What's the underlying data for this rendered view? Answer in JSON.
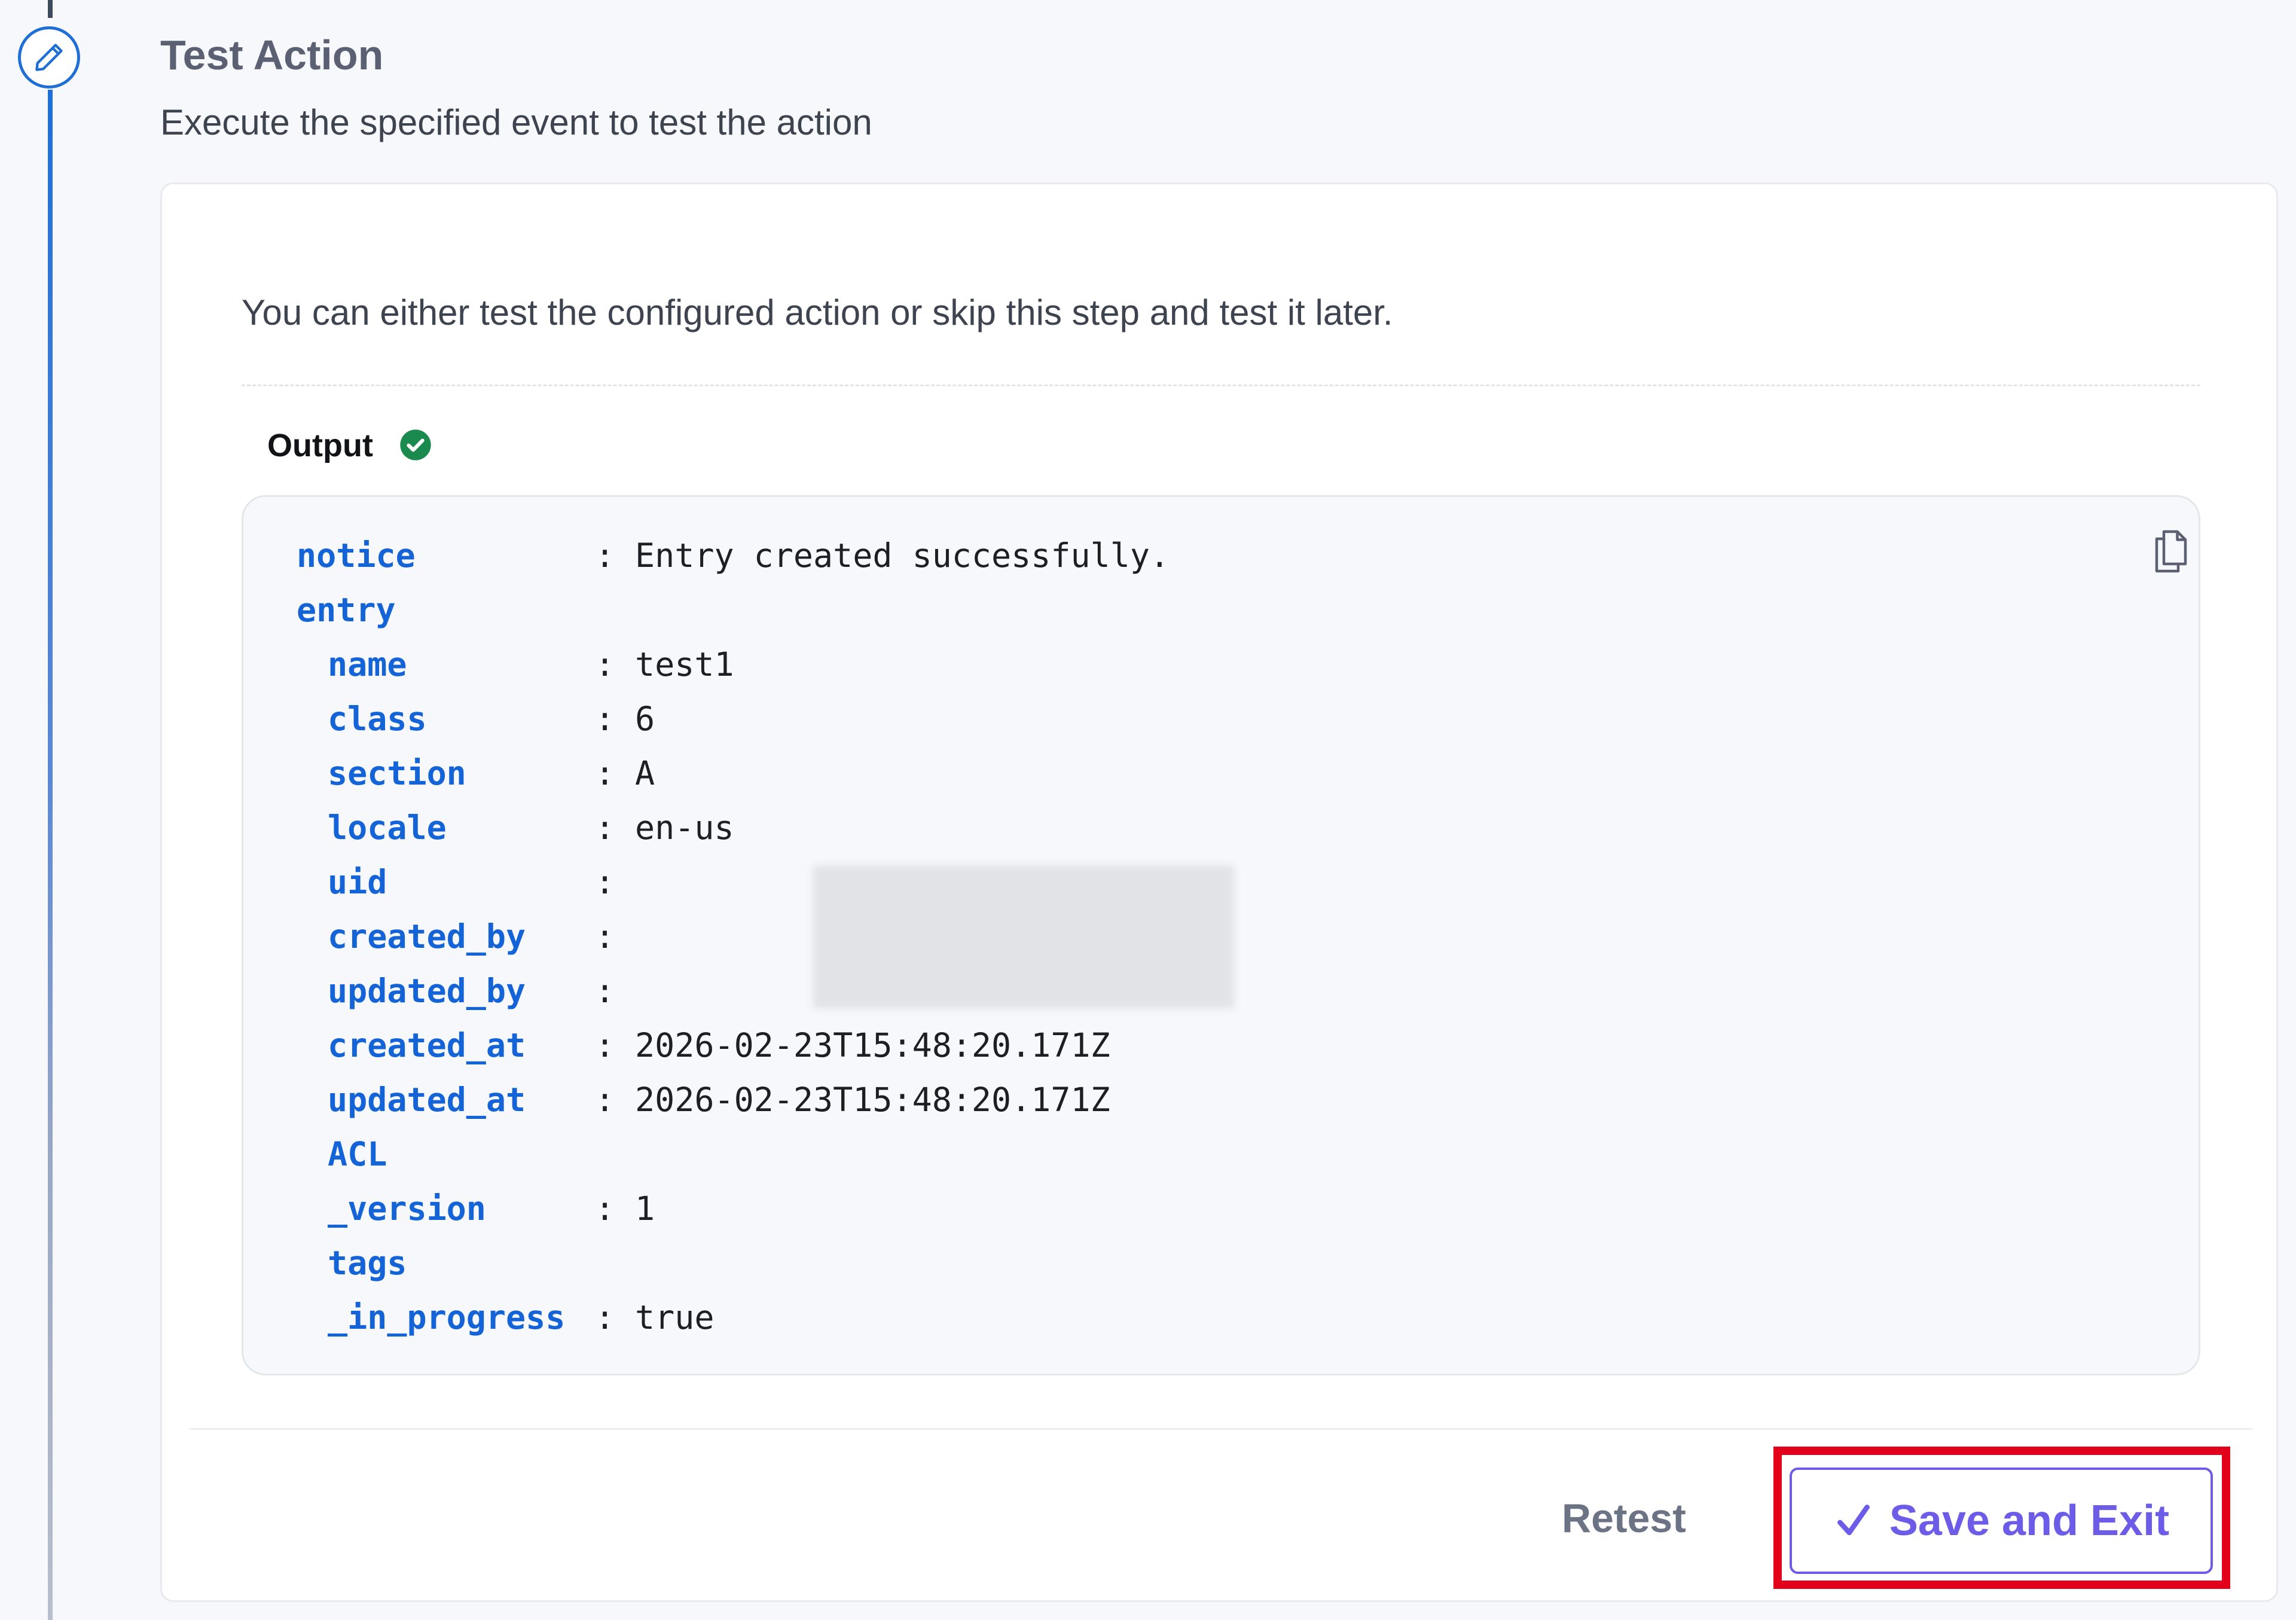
{
  "step": {
    "title": "Test Action",
    "description": "Execute the specified event to test the action",
    "icon": "pencil-icon"
  },
  "card": {
    "intro": "You can either test the configured action or skip this step and test it later.",
    "output_label": "Output",
    "output_status_icon": "check-circle-icon"
  },
  "output": {
    "copy_icon": "copy-icon",
    "rows": [
      {
        "key": "notice",
        "sep": ":",
        "value": "Entry created successfully."
      },
      {
        "key": "entry",
        "sep": "",
        "value": ""
      },
      {
        "key": "name",
        "sep": ":",
        "value": "test1"
      },
      {
        "key": "class",
        "sep": ":",
        "value": "6"
      },
      {
        "key": "section",
        "sep": ":",
        "value": "A"
      },
      {
        "key": "locale",
        "sep": ":",
        "value": "en-us"
      },
      {
        "key": "uid",
        "sep": ":",
        "value": ""
      },
      {
        "key": "created_by",
        "sep": ":",
        "value": ""
      },
      {
        "key": "updated_by",
        "sep": ":",
        "value": ""
      },
      {
        "key": "created_at",
        "sep": ":",
        "value": "2026-02-23T15:48:20.171Z"
      },
      {
        "key": "updated_at",
        "sep": ":",
        "value": "2026-02-23T15:48:20.171Z"
      },
      {
        "key": "ACL",
        "sep": "",
        "value": ""
      },
      {
        "key": "_version",
        "sep": ":",
        "value": "1"
      },
      {
        "key": "tags",
        "sep": "",
        "value": ""
      },
      {
        "key": "_in_progress",
        "sep": ":",
        "value": "true"
      }
    ]
  },
  "footer": {
    "retest_label": "Retest",
    "save_label": "Save and Exit",
    "save_icon": "checkmark-icon"
  },
  "colors": {
    "accent": "#1f6fd6",
    "key_blue": "#1464d8",
    "success_green": "#1a8a4f",
    "save_purple": "#6c5ce7",
    "highlight_red": "#e3001b"
  }
}
